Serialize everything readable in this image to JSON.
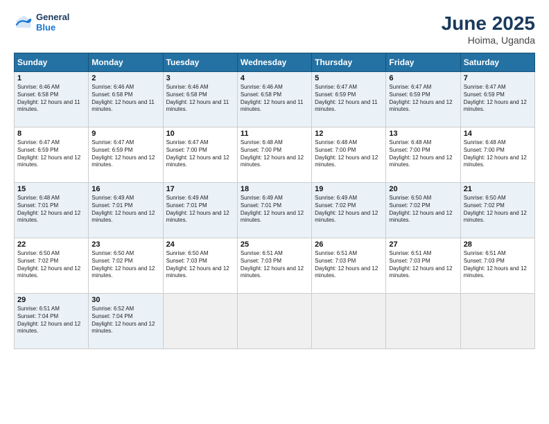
{
  "header": {
    "logo_line1": "General",
    "logo_line2": "Blue",
    "month": "June 2025",
    "location": "Hoima, Uganda"
  },
  "days_of_week": [
    "Sunday",
    "Monday",
    "Tuesday",
    "Wednesday",
    "Thursday",
    "Friday",
    "Saturday"
  ],
  "weeks": [
    [
      {
        "day": 1,
        "info": "Sunrise: 6:46 AM\nSunset: 6:58 PM\nDaylight: 12 hours and 11 minutes."
      },
      {
        "day": 2,
        "info": "Sunrise: 6:46 AM\nSunset: 6:58 PM\nDaylight: 12 hours and 11 minutes."
      },
      {
        "day": 3,
        "info": "Sunrise: 6:46 AM\nSunset: 6:58 PM\nDaylight: 12 hours and 11 minutes."
      },
      {
        "day": 4,
        "info": "Sunrise: 6:46 AM\nSunset: 6:58 PM\nDaylight: 12 hours and 11 minutes."
      },
      {
        "day": 5,
        "info": "Sunrise: 6:47 AM\nSunset: 6:59 PM\nDaylight: 12 hours and 11 minutes."
      },
      {
        "day": 6,
        "info": "Sunrise: 6:47 AM\nSunset: 6:59 PM\nDaylight: 12 hours and 12 minutes."
      },
      {
        "day": 7,
        "info": "Sunrise: 6:47 AM\nSunset: 6:59 PM\nDaylight: 12 hours and 12 minutes."
      }
    ],
    [
      {
        "day": 8,
        "info": "Sunrise: 6:47 AM\nSunset: 6:59 PM\nDaylight: 12 hours and 12 minutes."
      },
      {
        "day": 9,
        "info": "Sunrise: 6:47 AM\nSunset: 6:59 PM\nDaylight: 12 hours and 12 minutes."
      },
      {
        "day": 10,
        "info": "Sunrise: 6:47 AM\nSunset: 7:00 PM\nDaylight: 12 hours and 12 minutes."
      },
      {
        "day": 11,
        "info": "Sunrise: 6:48 AM\nSunset: 7:00 PM\nDaylight: 12 hours and 12 minutes."
      },
      {
        "day": 12,
        "info": "Sunrise: 6:48 AM\nSunset: 7:00 PM\nDaylight: 12 hours and 12 minutes."
      },
      {
        "day": 13,
        "info": "Sunrise: 6:48 AM\nSunset: 7:00 PM\nDaylight: 12 hours and 12 minutes."
      },
      {
        "day": 14,
        "info": "Sunrise: 6:48 AM\nSunset: 7:00 PM\nDaylight: 12 hours and 12 minutes."
      }
    ],
    [
      {
        "day": 15,
        "info": "Sunrise: 6:48 AM\nSunset: 7:01 PM\nDaylight: 12 hours and 12 minutes."
      },
      {
        "day": 16,
        "info": "Sunrise: 6:49 AM\nSunset: 7:01 PM\nDaylight: 12 hours and 12 minutes."
      },
      {
        "day": 17,
        "info": "Sunrise: 6:49 AM\nSunset: 7:01 PM\nDaylight: 12 hours and 12 minutes."
      },
      {
        "day": 18,
        "info": "Sunrise: 6:49 AM\nSunset: 7:01 PM\nDaylight: 12 hours and 12 minutes."
      },
      {
        "day": 19,
        "info": "Sunrise: 6:49 AM\nSunset: 7:02 PM\nDaylight: 12 hours and 12 minutes."
      },
      {
        "day": 20,
        "info": "Sunrise: 6:50 AM\nSunset: 7:02 PM\nDaylight: 12 hours and 12 minutes."
      },
      {
        "day": 21,
        "info": "Sunrise: 6:50 AM\nSunset: 7:02 PM\nDaylight: 12 hours and 12 minutes."
      }
    ],
    [
      {
        "day": 22,
        "info": "Sunrise: 6:50 AM\nSunset: 7:02 PM\nDaylight: 12 hours and 12 minutes."
      },
      {
        "day": 23,
        "info": "Sunrise: 6:50 AM\nSunset: 7:02 PM\nDaylight: 12 hours and 12 minutes."
      },
      {
        "day": 24,
        "info": "Sunrise: 6:50 AM\nSunset: 7:03 PM\nDaylight: 12 hours and 12 minutes."
      },
      {
        "day": 25,
        "info": "Sunrise: 6:51 AM\nSunset: 7:03 PM\nDaylight: 12 hours and 12 minutes."
      },
      {
        "day": 26,
        "info": "Sunrise: 6:51 AM\nSunset: 7:03 PM\nDaylight: 12 hours and 12 minutes."
      },
      {
        "day": 27,
        "info": "Sunrise: 6:51 AM\nSunset: 7:03 PM\nDaylight: 12 hours and 12 minutes."
      },
      {
        "day": 28,
        "info": "Sunrise: 6:51 AM\nSunset: 7:03 PM\nDaylight: 12 hours and 12 minutes."
      }
    ],
    [
      {
        "day": 29,
        "info": "Sunrise: 6:51 AM\nSunset: 7:04 PM\nDaylight: 12 hours and 12 minutes."
      },
      {
        "day": 30,
        "info": "Sunrise: 6:52 AM\nSunset: 7:04 PM\nDaylight: 12 hours and 12 minutes."
      },
      null,
      null,
      null,
      null,
      null
    ]
  ]
}
